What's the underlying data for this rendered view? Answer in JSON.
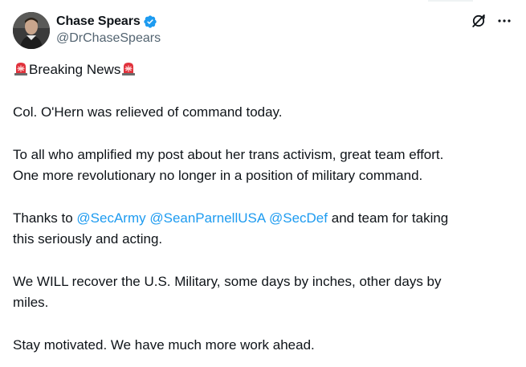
{
  "author": {
    "display_name": "Chase Spears",
    "handle": "@DrChaseSpears",
    "verified": true,
    "verified_color": "#1d9bf0"
  },
  "icons": {
    "verified": "verified-badge-icon",
    "grok": "grok-icon",
    "more": "more-options-icon",
    "siren": "police-light-emoji-icon"
  },
  "post": {
    "headline": "Breaking News",
    "para1": "Col. O'Hern was relieved of command today.",
    "para2_line1": "To all who amplified my post about her trans activism, great team effort.",
    "para2_line2": "One more revolutionary no longer in a position of military command.",
    "para3_prefix": "Thanks to",
    "mentions": [
      "@SecArmy",
      "@SeanParnellUSA",
      "@SecDef"
    ],
    "para3_suffix_line1": "and team for taking",
    "para3_line2": "this seriously and acting.",
    "para4_line1": "We WILL recover the U.S. Military, some days by inches, other days by",
    "para4_line2": "miles.",
    "para5": "Stay motivated. We have much more work ahead."
  },
  "colors": {
    "text": "#0f1419",
    "secondary": "#536471",
    "link": "#1d9bf0",
    "siren_red": "#e0323c"
  }
}
